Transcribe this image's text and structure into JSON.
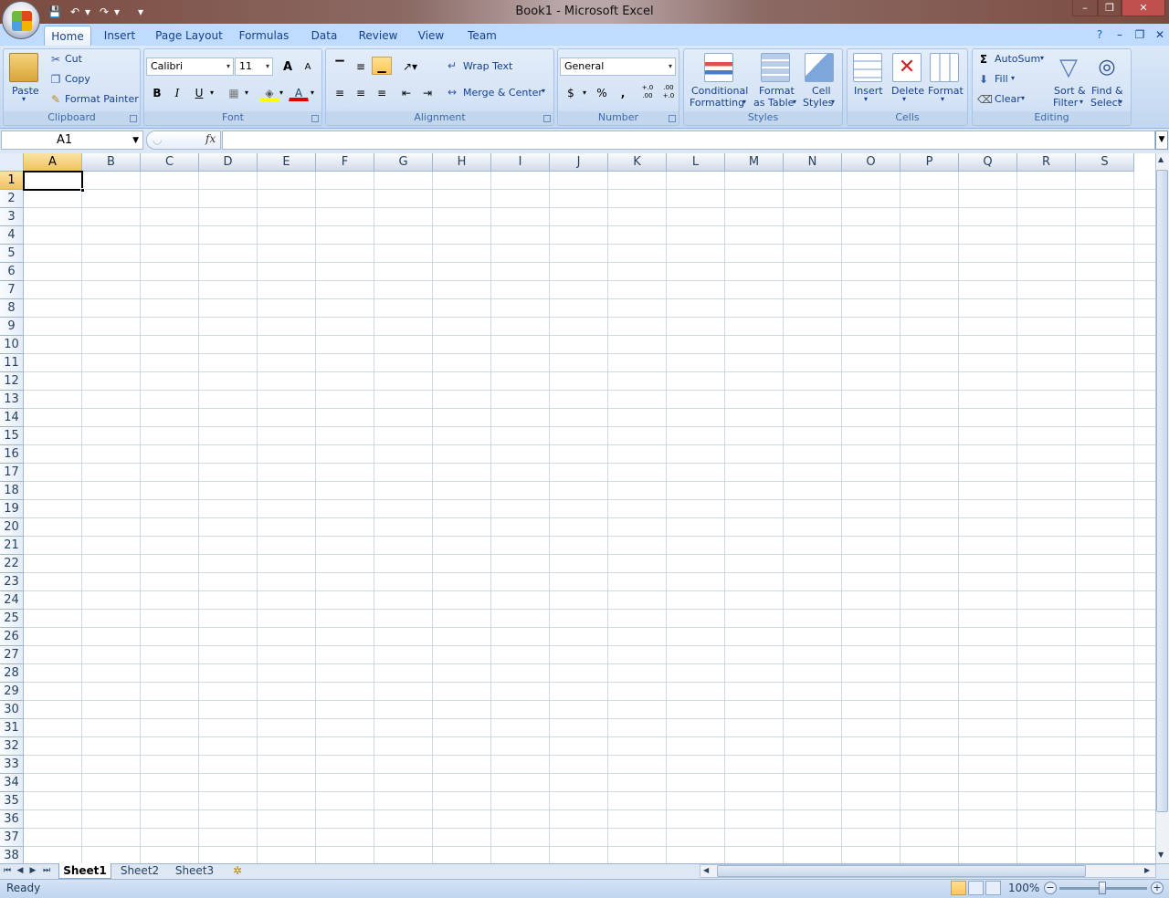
{
  "window": {
    "title": "Book1 - Microsoft Excel"
  },
  "qat": {
    "save_icon": "save-icon",
    "undo_icon": "undo-icon",
    "redo_icon": "redo-icon",
    "customize_icon": "customize-qat-icon"
  },
  "tabs": [
    "Home",
    "Insert",
    "Page Layout",
    "Formulas",
    "Data",
    "Review",
    "View",
    "Team"
  ],
  "clipboard": {
    "paste": "Paste",
    "cut": "Cut",
    "copy": "Copy",
    "format_painter": "Format Painter",
    "group": "Clipboard"
  },
  "font": {
    "name": "Calibri",
    "size": "11",
    "grow": "A",
    "shrink": "A",
    "bold": "B",
    "italic": "I",
    "underline": "U",
    "font_color": "A",
    "group": "Font"
  },
  "alignment": {
    "wrap_text": "Wrap Text",
    "merge_center": "Merge & Center",
    "group": "Alignment"
  },
  "number": {
    "format": "General",
    "currency": "$",
    "percent": "%",
    "comma": ",",
    "inc_decimal": "+.0 .00",
    "dec_decimal": ".00 +.0",
    "group": "Number"
  },
  "styles": {
    "cond_fmt_1": "Conditional",
    "cond_fmt_2": "Formatting",
    "fmt_table_1": "Format",
    "fmt_table_2": "as Table",
    "cell_styles_1": "Cell",
    "cell_styles_2": "Styles",
    "group": "Styles"
  },
  "cells": {
    "insert": "Insert",
    "delete": "Delete",
    "format": "Format",
    "group": "Cells"
  },
  "editing": {
    "autosum": "AutoSum",
    "fill": "Fill",
    "clear": "Clear",
    "sort_1": "Sort &",
    "sort_2": "Filter",
    "find_1": "Find &",
    "find_2": "Select",
    "group": "Editing"
  },
  "formula_bar": {
    "name_box": "A1",
    "fx": "fx",
    "value": ""
  },
  "grid": {
    "columns": [
      "A",
      "B",
      "C",
      "D",
      "E",
      "F",
      "G",
      "H",
      "I",
      "J",
      "K",
      "L",
      "M",
      "N",
      "O",
      "P",
      "Q",
      "R",
      "S"
    ],
    "rows": [
      "1",
      "2",
      "3",
      "4",
      "5",
      "6",
      "7",
      "8",
      "9",
      "10",
      "11",
      "12",
      "13",
      "14",
      "15",
      "16",
      "17",
      "18",
      "19",
      "20",
      "21",
      "22",
      "23",
      "24",
      "25",
      "26",
      "27",
      "28",
      "29",
      "30",
      "31",
      "32",
      "33",
      "34",
      "35",
      "36",
      "37",
      "38"
    ],
    "active_cell": "A1"
  },
  "sheets": [
    "Sheet1",
    "Sheet2",
    "Sheet3"
  ],
  "active_sheet": "Sheet1",
  "status": {
    "text": "Ready",
    "zoom": "100%"
  },
  "colors": {
    "accent": "#15428b",
    "ribbon": "#c9dcf3",
    "selected_header": "#f1c15f"
  }
}
